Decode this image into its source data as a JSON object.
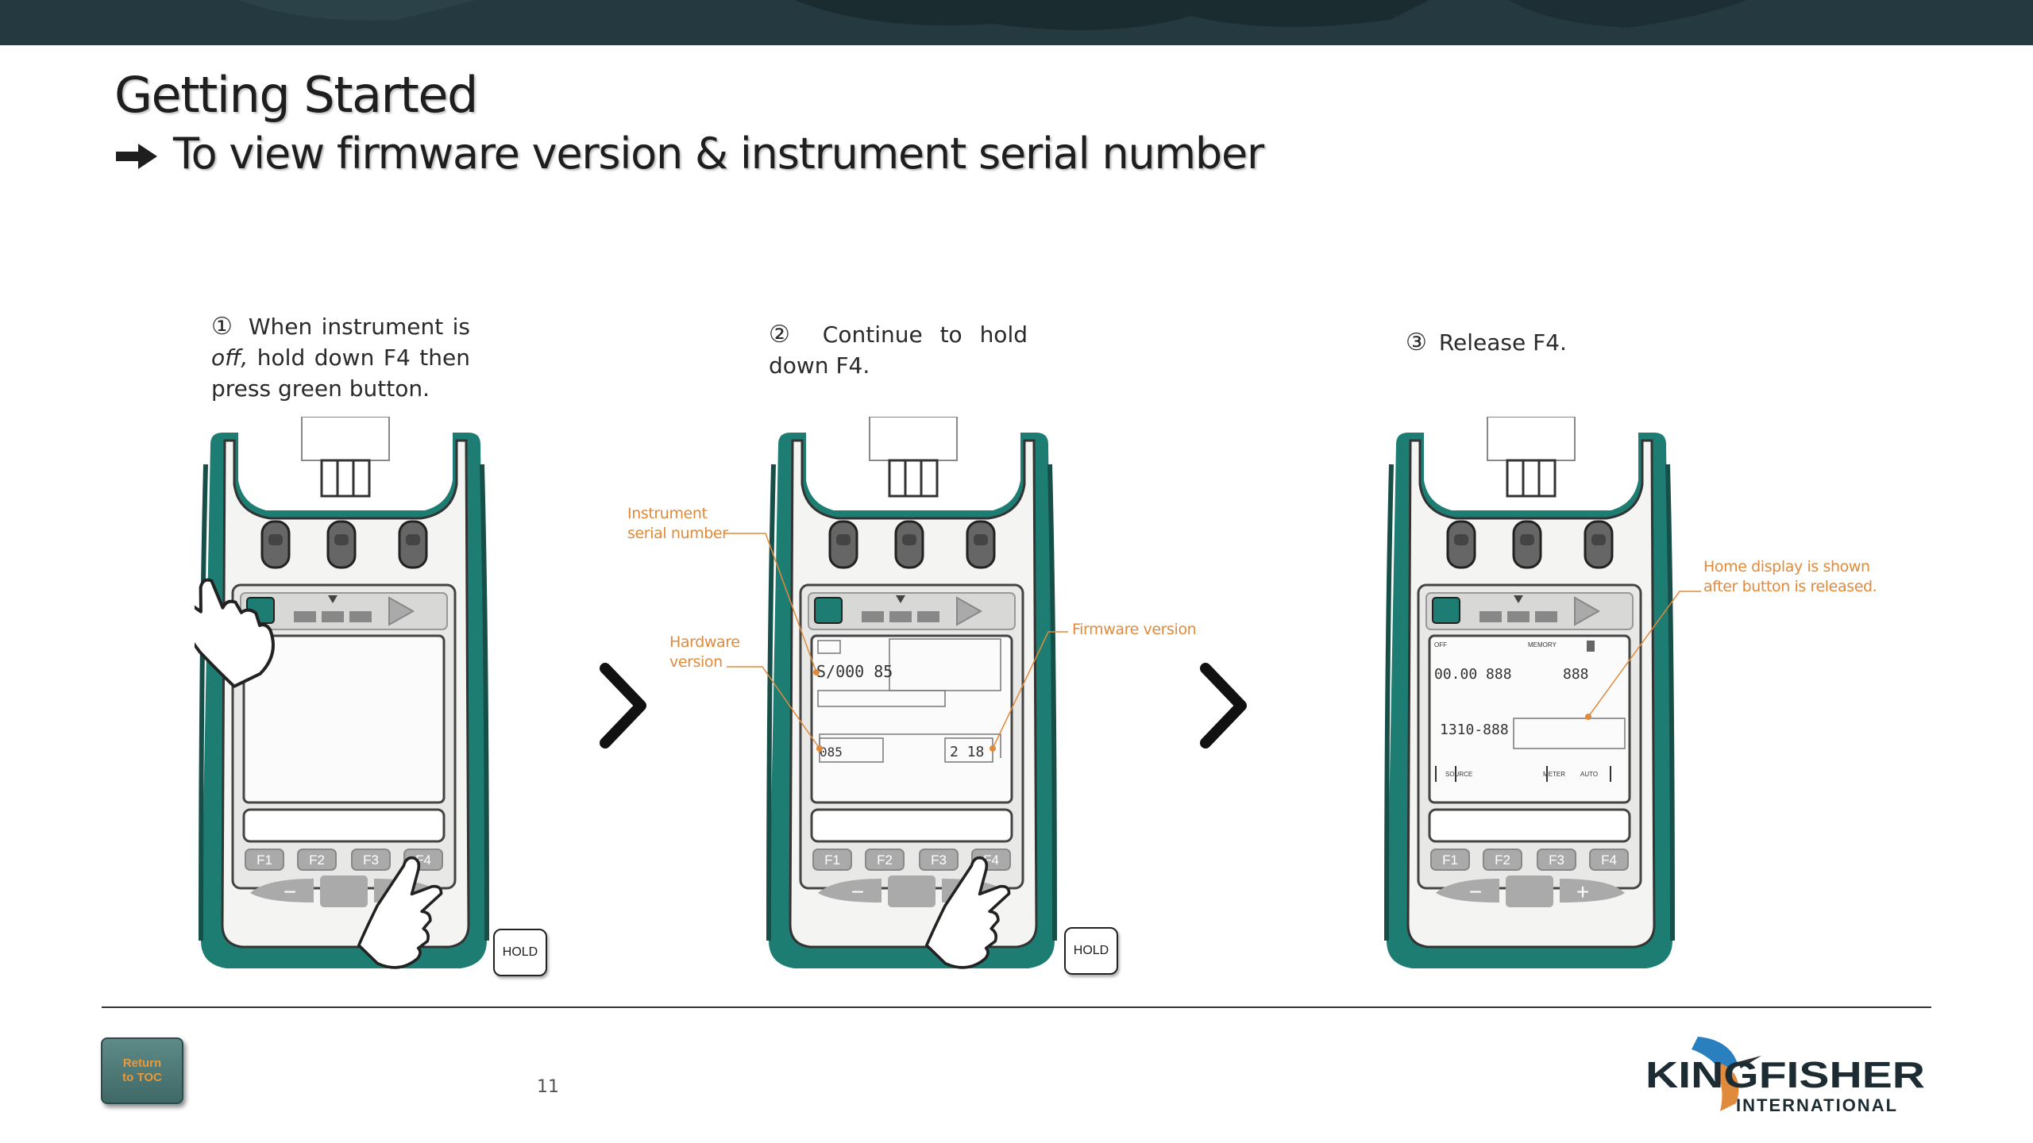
{
  "header": {
    "title": "Getting Started",
    "subtitle": "To view firmware version & instrument serial number"
  },
  "steps": [
    {
      "number": "①",
      "text_html_parts": [
        "When instrument is",
        "off,",
        "hold down F4 then press green button."
      ]
    },
    {
      "number": "②",
      "text": "Continue to hold down F4."
    },
    {
      "number": "③",
      "text": "Release F4."
    }
  ],
  "callouts": {
    "serial": [
      "Instrument",
      "serial number"
    ],
    "hardware": [
      "Hardware",
      "version"
    ],
    "firmware": "Firmware version",
    "home": [
      "Home display is shown",
      "after button is released."
    ]
  },
  "device": {
    "function_keys": [
      "F1",
      "F2",
      "F3",
      "F4"
    ],
    "minus": "−",
    "plus": "+",
    "hold_label": "HOLD",
    "lcd_home": {
      "off": "OFF",
      "memory": "MEMORY",
      "source": "SOURCE",
      "meter": "METER",
      "auto": "AUTO"
    }
  },
  "footer": {
    "toc_button": [
      "Return",
      "to TOC"
    ],
    "page_number": "11",
    "logo_main": "KINGFISHER",
    "logo_sub": "INTERNATIONAL"
  },
  "colors": {
    "header_bar": "#253a40",
    "device_body": "#1e7d72",
    "callout": "#e08a3c",
    "toc_button": "#4f7a78",
    "logo_bird": "#2a7fbf"
  }
}
